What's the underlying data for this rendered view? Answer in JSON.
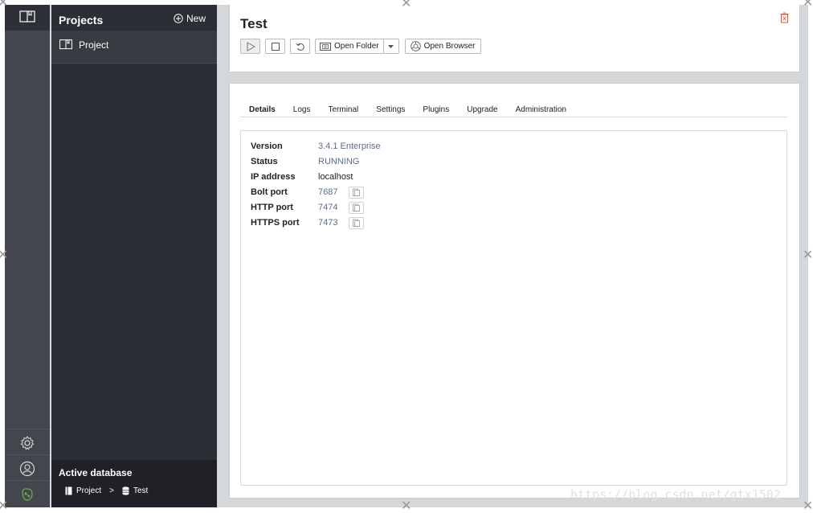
{
  "sidebar": {
    "icons": {
      "top": "book-icon",
      "settings": "gear-icon",
      "account": "user-icon",
      "brand": "neo4j-logo-icon"
    }
  },
  "projects": {
    "title": "Projects",
    "new_label": "New",
    "items": [
      {
        "label": "Project",
        "icon": "book-icon"
      }
    ]
  },
  "active_db": {
    "title": "Active database",
    "project": "Project",
    "separator": ">",
    "database": "Test"
  },
  "database": {
    "title": "Test",
    "toolbar": {
      "open_folder_label": "Open Folder",
      "open_browser_label": "Open Browser"
    }
  },
  "tabs": [
    "Details",
    "Logs",
    "Terminal",
    "Settings",
    "Plugins",
    "Upgrade",
    "Administration"
  ],
  "details": {
    "rows": [
      {
        "key": "Version",
        "value": "3.4.1 Enterprise"
      },
      {
        "key": "Status",
        "value": "RUNNING"
      },
      {
        "key": "IP address",
        "value": "localhost"
      },
      {
        "key": "Bolt port",
        "value": "7687"
      },
      {
        "key": "HTTP port",
        "value": "7474"
      },
      {
        "key": "HTTPS port",
        "value": "7473"
      }
    ]
  },
  "watermark": "https://blog.csdn.net/gtx1502",
  "colors": {
    "accent_green": "#6aa64b",
    "trash_red": "#e0533f",
    "value_blue": "#5b6c8c"
  }
}
